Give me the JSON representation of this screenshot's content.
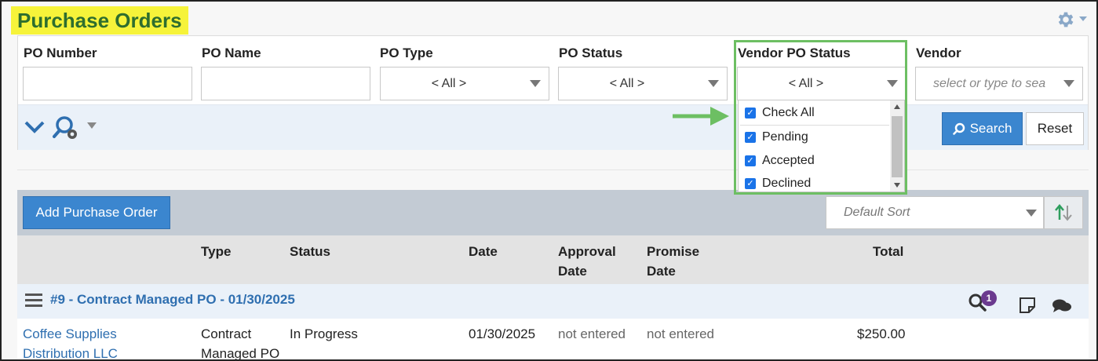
{
  "page": {
    "title": "Purchase Orders"
  },
  "header": {
    "settings_icon": "gear-icon"
  },
  "filters": {
    "po_number": {
      "label": "PO Number",
      "value": ""
    },
    "po_name": {
      "label": "PO Name",
      "value": ""
    },
    "po_type": {
      "label": "PO Type",
      "value": "< All >"
    },
    "po_status": {
      "label": "PO Status",
      "value": "< All >"
    },
    "vendor_po_status": {
      "label": "Vendor PO Status",
      "value": "< All >",
      "options": [
        {
          "label": "Check All",
          "checked": true
        },
        {
          "label": "Pending",
          "checked": true
        },
        {
          "label": "Accepted",
          "checked": true
        },
        {
          "label": "Declined",
          "checked": true
        }
      ]
    },
    "vendor": {
      "label": "Vendor",
      "placeholder": "select or type to sea"
    },
    "search_label": "Search",
    "reset_label": "Reset"
  },
  "results": {
    "add_button_label": "Add Purchase Order",
    "sort_placeholder": "Default Sort",
    "columns": {
      "type": "Type",
      "status": "Status",
      "date": "Date",
      "approval_date_1": "Approval",
      "approval_date_2": "Date",
      "promise_date_1": "Promise",
      "promise_date_2": "Date",
      "total": "Total"
    },
    "group": {
      "title": "#9 - Contract Managed PO - 01/30/2025",
      "search_badge": "1"
    },
    "row": {
      "vendor_1": "Coffee Supplies",
      "vendor_2": "Distribution LLC",
      "type_1": "Contract",
      "type_2": "Managed PO",
      "status": "In Progress",
      "date": "01/30/2025",
      "approval_date": "not entered",
      "promise_date": "not entered",
      "total": "$250.00"
    }
  },
  "colors": {
    "title_highlight": "#f6f33a",
    "title_text": "#2e6e2e",
    "accent_blue": "#3b86cf",
    "link_blue": "#2f6fb0",
    "annotation_green": "#6dbf63",
    "badge_purple": "#6b3a8f"
  }
}
